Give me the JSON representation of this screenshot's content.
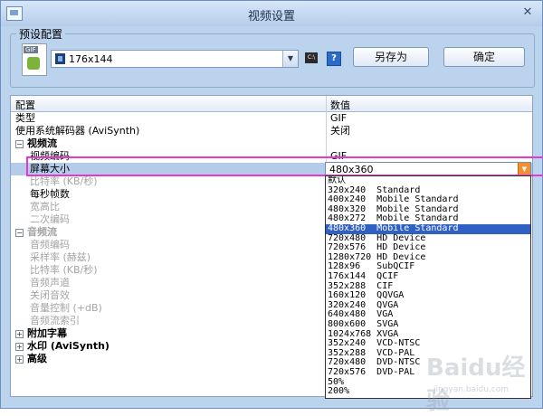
{
  "window": {
    "title": "视频设置",
    "close": "✕"
  },
  "preset": {
    "group_label": "预设配置",
    "gif_tag": "GIF",
    "selected": "176x144",
    "saveas_label": "另存为",
    "ok_label": "确定",
    "cmd_icon_text": "C:\\",
    "help_icon_text": "?"
  },
  "grid": {
    "col_name": "配置",
    "col_value": "数值",
    "rows": [
      {
        "name": "类型",
        "value": "GIF"
      },
      {
        "name": "使用系统解码器 (AviSynth)",
        "value": "关闭"
      },
      {
        "name": "视频流",
        "value": ""
      },
      {
        "name": "视频编码",
        "value": "GIF"
      },
      {
        "name": "屏幕大小",
        "value": ""
      },
      {
        "name": "比特率 (KB/秒)",
        "value": ""
      },
      {
        "name": "每秒帧数",
        "value": ""
      },
      {
        "name": "宽高比",
        "value": ""
      },
      {
        "name": "二次编码",
        "value": ""
      },
      {
        "name": "音频流",
        "value": ""
      },
      {
        "name": "音频编码",
        "value": ""
      },
      {
        "name": "采样率 (赫兹)",
        "value": ""
      },
      {
        "name": "比特率 (KB/秒)",
        "value": ""
      },
      {
        "name": "音频声道",
        "value": ""
      },
      {
        "name": "关闭音效",
        "value": ""
      },
      {
        "name": "音量控制 (+dB)",
        "value": ""
      },
      {
        "name": "音频流索引",
        "value": ""
      },
      {
        "name": "附加字幕",
        "value": ""
      },
      {
        "name": "水印 (AviSynth)",
        "value": ""
      },
      {
        "name": "高级",
        "value": ""
      }
    ]
  },
  "screen_size": {
    "current": "480x360",
    "options": [
      "默认",
      "320x240  Standard",
      "400x240  Mobile Standard",
      "480x320  Mobile Standard",
      "480x272  Mobile Standard",
      "480x360  Mobile Standard",
      "720x480  HD Device",
      "720x576  HD Device",
      "1280x720 HD Device",
      "128x96   SubQCIF",
      "176x144  QCIF",
      "352x288  CIF",
      "160x120  QQVGA",
      "320x240  QVGA",
      "640x480  VGA",
      "800x600  SVGA",
      "1024x768 XVGA",
      "352x240  VCD-NTSC",
      "352x288  VCD-PAL",
      "720x480  DVD-NTSC",
      "720x576  DVD-PAL",
      "50%",
      "200%"
    ],
    "active_index": 5
  },
  "watermark": {
    "text": "Baidu经验",
    "sub": "jingyan.baidu.com"
  },
  "colors": {
    "highlight": "#e23ad0",
    "selection": "#3060c4",
    "arrow": "#f29030"
  }
}
